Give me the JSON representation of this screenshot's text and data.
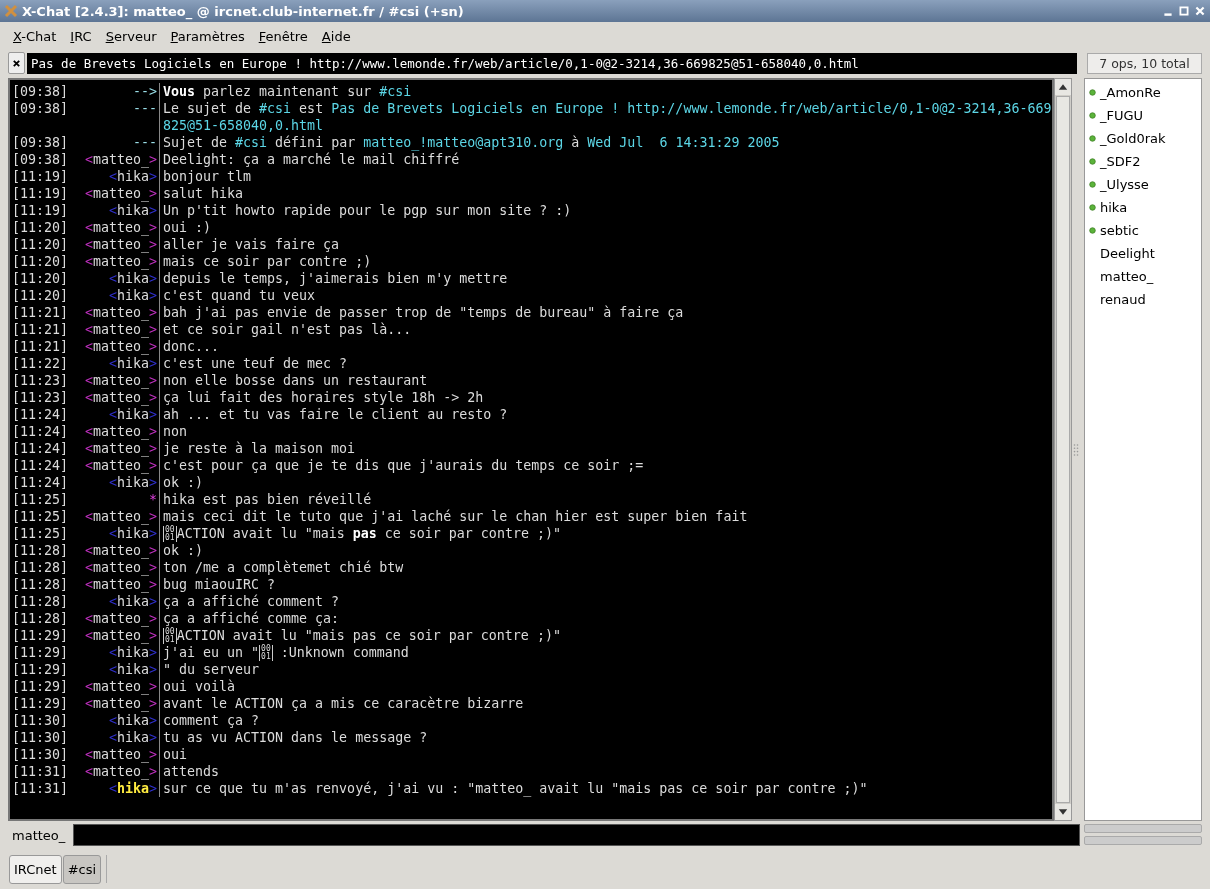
{
  "window": {
    "title": "X-Chat [2.4.3]: matteo_ @ ircnet.club-internet.fr / #csi (+sn)"
  },
  "menu": [
    "X-Chat",
    "IRC",
    "Serveur",
    "Paramètres",
    "Fenêtre",
    "Aide"
  ],
  "topic": "Pas de Brevets Logiciels en Europe ! http://www.lemonde.fr/web/article/0,1-0@2-3214,36-669825@51-658040,0.html",
  "lines": [
    {
      "time": "[09:38]",
      "kind": "event",
      "marker": "-->",
      "segments": [
        {
          "text": "Vous",
          "kind": "bold"
        },
        {
          "text": " parlez maintenant sur ",
          "kind": "plain"
        },
        {
          "text": "#csi",
          "kind": "link"
        }
      ]
    },
    {
      "time": "[09:38]",
      "kind": "event",
      "marker": "---",
      "segments": [
        {
          "text": "Le sujet de ",
          "kind": "plain"
        },
        {
          "text": "#csi",
          "kind": "link"
        },
        {
          "text": " est ",
          "kind": "plain"
        },
        {
          "text": "Pas de Brevets Logiciels en Europe ! http://www.lemonde.fr/web/article/0,1-0@2-3214,36-669825@51-658040,0.html",
          "kind": "link"
        }
      ]
    },
    {
      "time": "[09:38]",
      "kind": "event",
      "marker": "---",
      "segments": [
        {
          "text": "Sujet de ",
          "kind": "plain"
        },
        {
          "text": "#csi",
          "kind": "link"
        },
        {
          "text": " défini par ",
          "kind": "plain"
        },
        {
          "text": "matteo_!matteo@apt310.org",
          "kind": "link"
        },
        {
          "text": " à ",
          "kind": "plain"
        },
        {
          "text": "Wed Jul  6 14:31:29 2005",
          "kind": "link"
        }
      ]
    },
    {
      "time": "[09:38]",
      "kind": "nick",
      "open": "<",
      "nick": "matteo_",
      "close": ">",
      "color": "#c030c0",
      "highlight": false,
      "text": "Deelight: ça a marché le mail chiffré"
    },
    {
      "time": "[11:19]",
      "kind": "nick",
      "open": "<",
      "nick": "hika",
      "close": ">",
      "color": "#3030d0",
      "highlight": false,
      "text": "bonjour tlm"
    },
    {
      "time": "[11:19]",
      "kind": "nick",
      "open": "<",
      "nick": "matteo_",
      "close": ">",
      "color": "#c030c0",
      "highlight": false,
      "text": "salut hika"
    },
    {
      "time": "[11:19]",
      "kind": "nick",
      "open": "<",
      "nick": "hika",
      "close": ">",
      "color": "#3030d0",
      "highlight": false,
      "text": "Un p'tit howto rapide pour le pgp sur mon site ? :)"
    },
    {
      "time": "[11:20]",
      "kind": "nick",
      "open": "<",
      "nick": "matteo_",
      "close": ">",
      "color": "#c030c0",
      "highlight": false,
      "text": "oui :)"
    },
    {
      "time": "[11:20]",
      "kind": "nick",
      "open": "<",
      "nick": "matteo_",
      "close": ">",
      "color": "#c030c0",
      "highlight": false,
      "text": "aller je vais faire ça"
    },
    {
      "time": "[11:20]",
      "kind": "nick",
      "open": "<",
      "nick": "matteo_",
      "close": ">",
      "color": "#c030c0",
      "highlight": false,
      "text": "mais ce soir par contre ;)"
    },
    {
      "time": "[11:20]",
      "kind": "nick",
      "open": "<",
      "nick": "hika",
      "close": ">",
      "color": "#3030d0",
      "highlight": false,
      "text": "depuis le temps, j'aimerais bien m'y mettre"
    },
    {
      "time": "[11:20]",
      "kind": "nick",
      "open": "<",
      "nick": "hika",
      "close": ">",
      "color": "#3030d0",
      "highlight": false,
      "text": "c'est quand tu veux"
    },
    {
      "time": "[11:21]",
      "kind": "nick",
      "open": "<",
      "nick": "matteo_",
      "close": ">",
      "color": "#c030c0",
      "highlight": false,
      "text": "bah j'ai pas envie de passer trop de \"temps de bureau\" à faire ça"
    },
    {
      "time": "[11:21]",
      "kind": "nick",
      "open": "<",
      "nick": "matteo_",
      "close": ">",
      "color": "#c030c0",
      "highlight": false,
      "text": "et ce soir gail n'est pas là..."
    },
    {
      "time": "[11:21]",
      "kind": "nick",
      "open": "<",
      "nick": "matteo_",
      "close": ">",
      "color": "#c030c0",
      "highlight": false,
      "text": "donc..."
    },
    {
      "time": "[11:22]",
      "kind": "nick",
      "open": "<",
      "nick": "hika",
      "close": ">",
      "color": "#3030d0",
      "highlight": false,
      "text": "c'est une teuf de mec ?"
    },
    {
      "time": "[11:23]",
      "kind": "nick",
      "open": "<",
      "nick": "matteo_",
      "close": ">",
      "color": "#c030c0",
      "highlight": false,
      "text": "non elle bosse dans un restaurant"
    },
    {
      "time": "[11:23]",
      "kind": "nick",
      "open": "<",
      "nick": "matteo_",
      "close": ">",
      "color": "#c030c0",
      "highlight": false,
      "text": "ça lui fait des horaires style 18h -> 2h"
    },
    {
      "time": "[11:24]",
      "kind": "nick",
      "open": "<",
      "nick": "hika",
      "close": ">",
      "color": "#3030d0",
      "highlight": false,
      "text": "ah ... et tu vas faire le client au resto ?"
    },
    {
      "time": "[11:24]",
      "kind": "nick",
      "open": "<",
      "nick": "matteo_",
      "close": ">",
      "color": "#c030c0",
      "highlight": false,
      "text": "non"
    },
    {
      "time": "[11:24]",
      "kind": "nick",
      "open": "<",
      "nick": "matteo_",
      "close": ">",
      "color": "#c030c0",
      "highlight": false,
      "text": "je reste à la maison moi"
    },
    {
      "time": "[11:24]",
      "kind": "nick",
      "open": "<",
      "nick": "matteo_",
      "close": ">",
      "color": "#c030c0",
      "highlight": false,
      "text": "c'est pour ça que je te dis que j'aurais du temps ce soir ;="
    },
    {
      "time": "[11:24]",
      "kind": "nick",
      "open": "<",
      "nick": "hika",
      "close": ">",
      "color": "#3030d0",
      "highlight": false,
      "text": "ok :)"
    },
    {
      "time": "[11:25]",
      "kind": "action",
      "marker": "*",
      "text": "hika est pas bien réveillé"
    },
    {
      "time": "[11:25]",
      "kind": "nick",
      "open": "<",
      "nick": "matteo_",
      "close": ">",
      "color": "#c030c0",
      "highlight": false,
      "text": "mais ceci dit le tuto que j'ai laché sur le chan hier est super bien fait"
    },
    {
      "time": "[11:25]",
      "kind": "nick",
      "open": "<",
      "nick": "hika",
      "close": ">",
      "color": "#3030d0",
      "highlight": false,
      "segments": [
        {
          "text": "0001",
          "kind": "hexbox"
        },
        {
          "text": "ACTION avait lu \"mais ",
          "kind": "plain"
        },
        {
          "text": "pas",
          "kind": "bold"
        },
        {
          "text": " ce soir par contre ;)\"",
          "kind": "plain"
        }
      ]
    },
    {
      "time": "[11:28]",
      "kind": "nick",
      "open": "<",
      "nick": "matteo_",
      "close": ">",
      "color": "#c030c0",
      "highlight": false,
      "text": "ok :)"
    },
    {
      "time": "[11:28]",
      "kind": "nick",
      "open": "<",
      "nick": "matteo_",
      "close": ">",
      "color": "#c030c0",
      "highlight": false,
      "text": "ton /me a complètemet chié btw"
    },
    {
      "time": "[11:28]",
      "kind": "nick",
      "open": "<",
      "nick": "matteo_",
      "close": ">",
      "color": "#c030c0",
      "highlight": false,
      "text": "bug miaouIRC ?"
    },
    {
      "time": "[11:28]",
      "kind": "nick",
      "open": "<",
      "nick": "hika",
      "close": ">",
      "color": "#3030d0",
      "highlight": false,
      "text": "ça a affiché comment ?"
    },
    {
      "time": "[11:28]",
      "kind": "nick",
      "open": "<",
      "nick": "matteo_",
      "close": ">",
      "color": "#c030c0",
      "highlight": false,
      "text": "ça a affiché comme ça:"
    },
    {
      "time": "[11:29]",
      "kind": "nick",
      "open": "<",
      "nick": "matteo_",
      "close": ">",
      "color": "#c030c0",
      "highlight": false,
      "segments": [
        {
          "text": "0001",
          "kind": "hexbox"
        },
        {
          "text": "ACTION avait lu \"mais pas ce soir par contre ;)\"",
          "kind": "plain"
        }
      ]
    },
    {
      "time": "[11:29]",
      "kind": "nick",
      "open": "<",
      "nick": "hika",
      "close": ">",
      "color": "#3030d0",
      "highlight": false,
      "segments": [
        {
          "text": "j'ai eu un \"",
          "kind": "plain"
        },
        {
          "text": "0001",
          "kind": "hexbox"
        },
        {
          "text": " :Unknown command",
          "kind": "plain"
        }
      ]
    },
    {
      "time": "[11:29]",
      "kind": "nick",
      "open": "<",
      "nick": "hika",
      "close": ">",
      "color": "#3030d0",
      "highlight": false,
      "text": "\" du serveur"
    },
    {
      "time": "[11:29]",
      "kind": "nick",
      "open": "<",
      "nick": "matteo_",
      "close": ">",
      "color": "#c030c0",
      "highlight": false,
      "text": "oui voilà"
    },
    {
      "time": "[11:29]",
      "kind": "nick",
      "open": "<",
      "nick": "matteo_",
      "close": ">",
      "color": "#c030c0",
      "highlight": false,
      "text": "avant le ACTION ça a mis ce caracètre bizarre"
    },
    {
      "time": "[11:30]",
      "kind": "nick",
      "open": "<",
      "nick": "hika",
      "close": ">",
      "color": "#3030d0",
      "highlight": false,
      "text": "comment ça ?"
    },
    {
      "time": "[11:30]",
      "kind": "nick",
      "open": "<",
      "nick": "hika",
      "close": ">",
      "color": "#3030d0",
      "highlight": false,
      "text": "tu as vu ACTION dans le message ?"
    },
    {
      "time": "[11:30]",
      "kind": "nick",
      "open": "<",
      "nick": "matteo_",
      "close": ">",
      "color": "#c030c0",
      "highlight": false,
      "text": "oui"
    },
    {
      "time": "[11:31]",
      "kind": "nick",
      "open": "<",
      "nick": "matteo_",
      "close": ">",
      "color": "#c030c0",
      "highlight": false,
      "text": "attends"
    },
    {
      "time": "[11:31]",
      "kind": "nick",
      "open": "<",
      "nick": "hika",
      "close": ">",
      "color": "#3030d0",
      "highlight": true,
      "text": "sur ce que tu m'as renvoyé, j'ai vu : \"matteo_ avait lu \"mais pas ce soir par contre ;)\""
    }
  ],
  "userlist": {
    "summary": "7 ops, 10 total",
    "users": [
      {
        "name": "_AmonRe",
        "op": true
      },
      {
        "name": "_FUGU",
        "op": true
      },
      {
        "name": "_Gold0rak",
        "op": true
      },
      {
        "name": "_SDF2",
        "op": true
      },
      {
        "name": "_Ulysse",
        "op": true
      },
      {
        "name": "hika",
        "op": true
      },
      {
        "name": "sebtic",
        "op": true
      },
      {
        "name": "Deelight",
        "op": false
      },
      {
        "name": "matteo_",
        "op": false
      },
      {
        "name": "renaud",
        "op": false
      }
    ]
  },
  "input": {
    "nick": "matteo_"
  },
  "tabs": [
    {
      "label": "IRCnet",
      "selected": false
    },
    {
      "label": "#csi",
      "selected": true
    }
  ]
}
